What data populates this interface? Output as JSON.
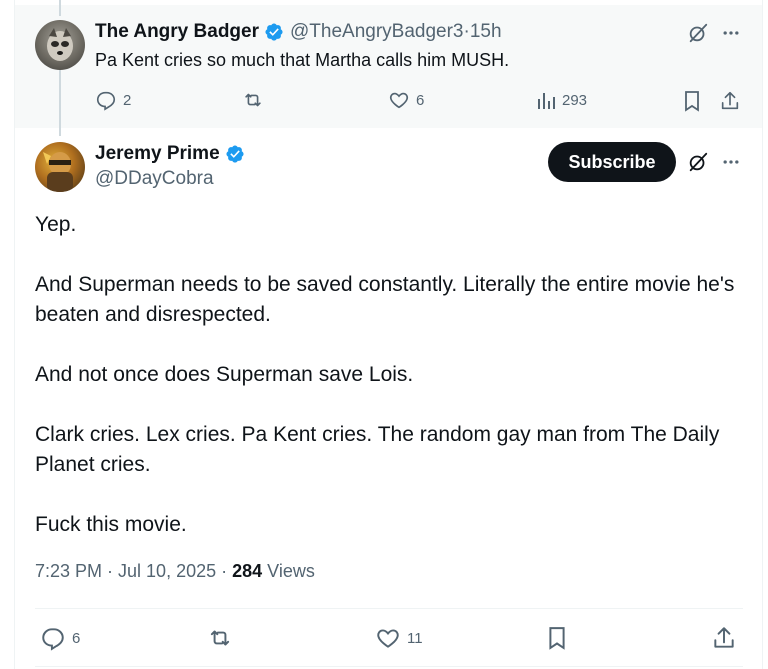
{
  "parent": {
    "author_name": "The Angry Badger",
    "handle": "@TheAngryBadger3",
    "separator": " · ",
    "time": "15h",
    "text": "Pa Kent cries so much that Martha calls him MUSH.",
    "stats": {
      "replies": "2",
      "likes": "6",
      "views": "293"
    }
  },
  "main": {
    "author_name": "Jeremy Prime",
    "handle": "@DDayCobra",
    "subscribe_label": "Subscribe",
    "paragraphs": [
      "Yep.",
      "And Superman needs to be saved constantly. Literally the entire movie he's beaten and disrespected.",
      "And not once does Superman save Lois.",
      "Clark cries. Lex cries. Pa Kent cries. The random gay man from The Daily Planet cries.",
      "Fuck this movie."
    ],
    "timestamp": "7:23 PM · Jul 10, 2025",
    "meta_sep": " · ",
    "views_count": "284",
    "views_label": " Views",
    "stats": {
      "replies": "6",
      "likes": "11"
    }
  },
  "colors": {
    "verified": "#1d9bf0",
    "muted": "#536471",
    "text": "#0f1419"
  },
  "icons": [
    "verified-badge-icon",
    "grok-icon",
    "more-icon",
    "reply-icon",
    "retweet-icon",
    "like-icon",
    "views-icon",
    "bookmark-icon",
    "share-icon"
  ]
}
